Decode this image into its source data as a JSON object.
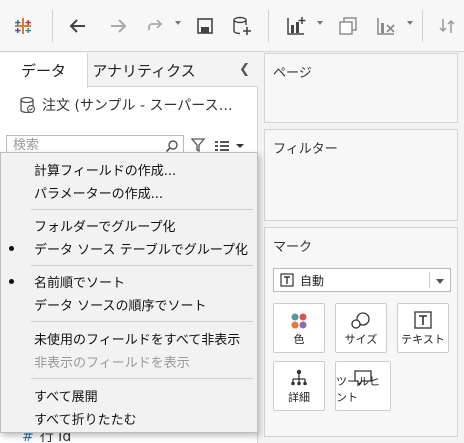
{
  "toolbar": {
    "icons": [
      "tableau-logo-icon",
      "back-arrow-icon",
      "forward-arrow-icon",
      "redo-icon",
      "save-icon",
      "new-datasource-icon",
      "new-worksheet-icon",
      "duplicate-icon",
      "clear-sheet-icon",
      "swap-icon"
    ]
  },
  "left_pane": {
    "tabs": [
      "データ",
      "アナリティクス"
    ],
    "datasource_label": "注文 (サンプル - スーパース…",
    "search_placeholder": "検索",
    "field_peek": "行 Id"
  },
  "context_menu": {
    "items": [
      {
        "label": "計算フィールドの作成...",
        "checked": false,
        "disabled": false
      },
      {
        "label": "パラメーターの作成...",
        "checked": false,
        "disabled": false
      },
      {
        "label": "フォルダーでグループ化",
        "checked": false,
        "disabled": false
      },
      {
        "label": "データ ソース テーブルでグループ化",
        "checked": true,
        "disabled": false
      },
      {
        "label": "名前順でソート",
        "checked": true,
        "disabled": false
      },
      {
        "label": "データ ソースの順序でソート",
        "checked": false,
        "disabled": false
      },
      {
        "label": "未使用のフィールドをすべて非表示",
        "checked": false,
        "disabled": false
      },
      {
        "label": "非表示のフィールドを表示",
        "checked": false,
        "disabled": true
      },
      {
        "label": "すべて展開",
        "checked": false,
        "disabled": false
      },
      {
        "label": "すべて折りたたむ",
        "checked": false,
        "disabled": false
      }
    ]
  },
  "shelves": {
    "pages_title": "ページ",
    "filters_title": "フィルター",
    "marks_title": "マーク",
    "marks_type": "自動",
    "mark_cards": [
      "色",
      "サイズ",
      "テキスト",
      "詳細",
      "ツールヒント"
    ]
  },
  "colors": {
    "tableau_blue": "#1f77b4",
    "tableau_orange": "#e8762d",
    "dot_teal": "#4e9a9a",
    "dot_red": "#d9534f",
    "dot_purple": "#8e6bb8"
  }
}
